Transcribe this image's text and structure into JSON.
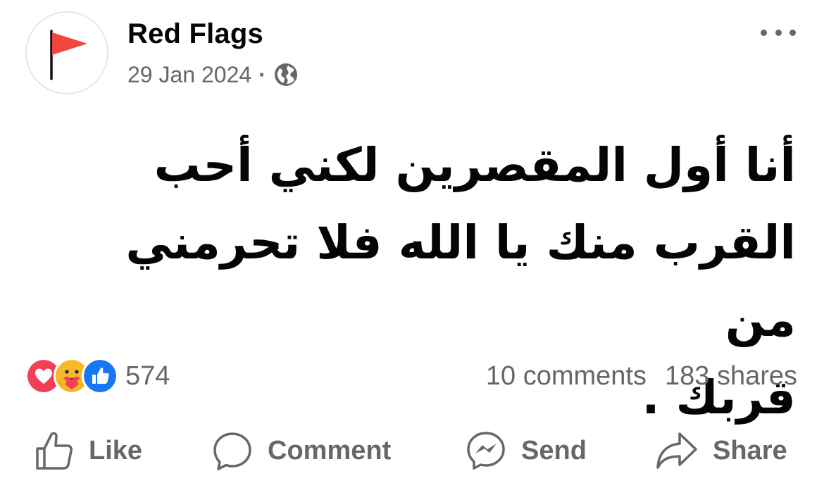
{
  "post": {
    "page_name": "Red Flags",
    "date": "29 Jan 2024",
    "separator": "·",
    "audience_icon": "globe-icon",
    "text": "أنا أول المقصرين لكني أحب\nالقرب منك يا الله  فلا تحرمني من\nقربك ."
  },
  "engagement": {
    "reaction_icons": [
      "love-reaction-icon",
      "care-reaction-icon",
      "like-reaction-icon"
    ],
    "reaction_count": "574",
    "comments": "10 comments",
    "shares": "183 shares"
  },
  "actions": {
    "like": "Like",
    "comment": "Comment",
    "send": "Send",
    "share": "Share"
  },
  "colors": {
    "text": "#050505",
    "secondary": "#65676b",
    "flag_red": "#f0463c",
    "like_blue": "#1877f2",
    "love_red": "#f33e58",
    "care_yellow": "#f7b928"
  }
}
